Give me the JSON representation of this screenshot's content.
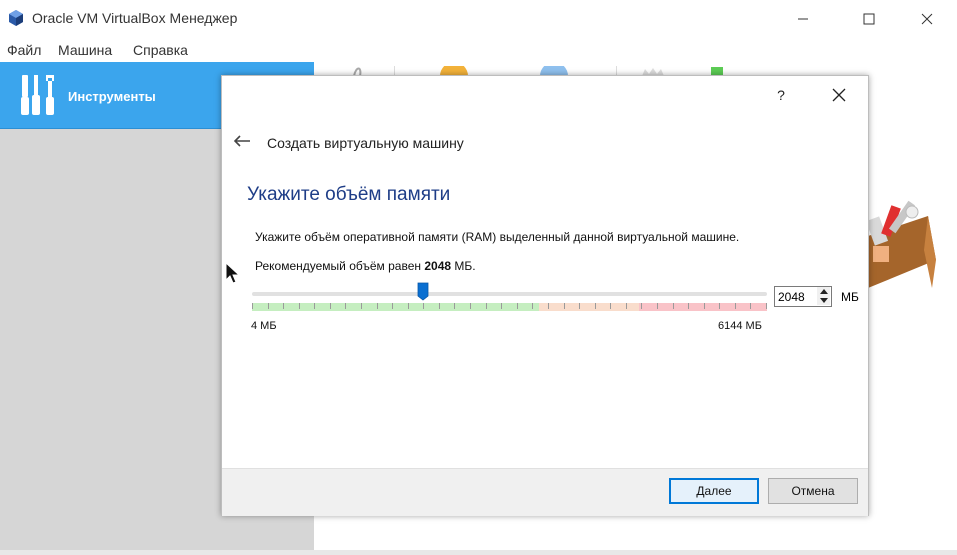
{
  "window": {
    "title": "Oracle VM VirtualBox Менеджер",
    "menu": [
      "Файл",
      "Машина",
      "Справка"
    ]
  },
  "sidebar": {
    "tools_label": "Инструменты"
  },
  "dialog": {
    "help": "?",
    "wizard_title": "Создать виртуальную машину",
    "heading": "Укажите объём памяти",
    "description": "Укажите объём оперативной памяти (RAM) выделенный данной виртуальной машине.",
    "recommended_prefix": "Рекомендуемый объём равен ",
    "recommended_value": "2048",
    "recommended_suffix": " МБ.",
    "memory_value": "2048",
    "memory_fraction": 0.333,
    "unit": "МБ",
    "min_label": "4 МБ",
    "max_label": "6144 МБ",
    "next_label": "Далее",
    "cancel_label": "Отмена"
  },
  "colors": {
    "accent": "#3ba5ed",
    "heading": "#1e3d87",
    "slider_handle": "#0a6fd1"
  }
}
